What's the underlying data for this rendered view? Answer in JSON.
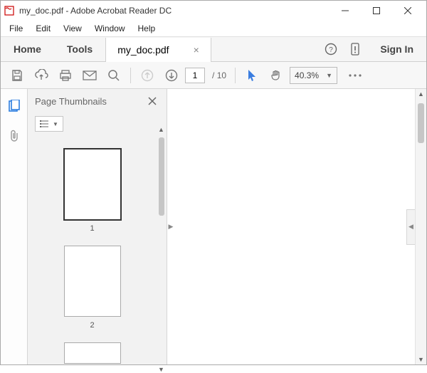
{
  "title": "my_doc.pdf - Adobe Acrobat Reader DC",
  "menu": [
    "File",
    "Edit",
    "View",
    "Window",
    "Help"
  ],
  "tabs": {
    "main": [
      "Home",
      "Tools"
    ],
    "doc": "my_doc.pdf",
    "signin": "Sign In"
  },
  "toolbar": {
    "page_current": "1",
    "page_sep": "/",
    "page_total": "10",
    "zoom": "40.3%"
  },
  "thumbnails": {
    "title": "Page Thumbnails",
    "items": [
      {
        "n": "1",
        "selected": true
      },
      {
        "n": "2",
        "selected": false
      }
    ]
  }
}
